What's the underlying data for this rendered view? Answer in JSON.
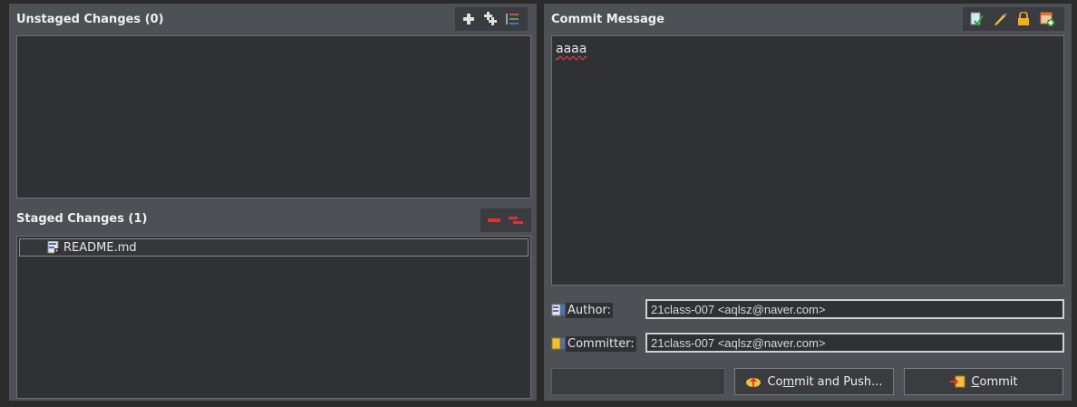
{
  "unstaged": {
    "title": "Unstaged Changes (0)",
    "toolbar": [
      {
        "icon": "add-icon",
        "tooltip": ""
      },
      {
        "icon": "add-all-icon",
        "tooltip": ""
      },
      {
        "icon": "list-view-icon",
        "tooltip": ""
      }
    ]
  },
  "staged": {
    "title": "Staged Changes (1)",
    "files": [
      {
        "name": "README.md",
        "icon": "modified-file-icon"
      }
    ]
  },
  "commit": {
    "title": "Commit Message",
    "message": "aaaa",
    "author_label": "Author:",
    "author_value": "21class-007 <aqlsz@naver.com>",
    "committer_label": "Committer:",
    "committer_value": "21class-007 <aqlsz@naver.com>",
    "commit_push_pre": "Co",
    "commit_push_ul": "m",
    "commit_push_post": "mit and Push...",
    "commit_ul": "C",
    "commit_post": "ommit"
  },
  "colors": {
    "background": "#2b2b2b",
    "pane": "#4d5054",
    "field": "#2f3135",
    "remove": "#e03030"
  }
}
